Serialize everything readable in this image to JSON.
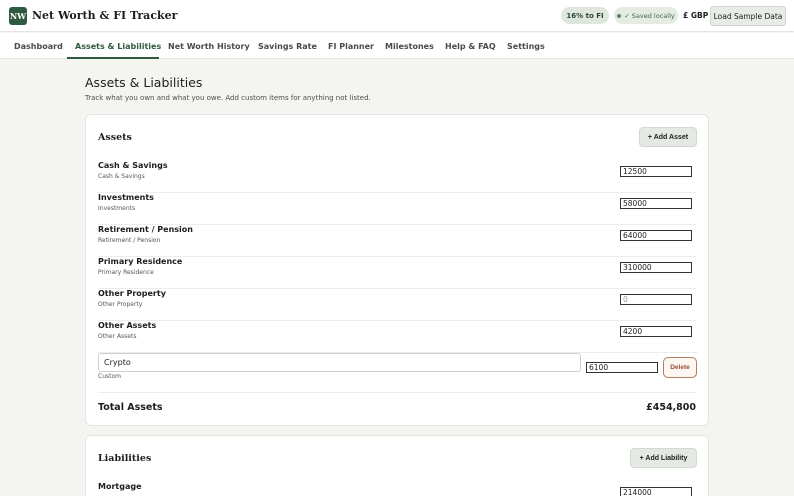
{
  "header": {
    "logo_text": "NW",
    "app_title": "Net Worth & FI Tracker",
    "fi_progress": "16% to FI",
    "saved_status": "✓ Saved locally",
    "currency": "£ GBP",
    "load_sample_label": "Load Sample Data"
  },
  "nav": {
    "tabs": [
      {
        "label": "Dashboard"
      },
      {
        "label": "Assets & Liabilities"
      },
      {
        "label": "Net Worth History"
      },
      {
        "label": "Savings Rate"
      },
      {
        "label": "FI Planner"
      },
      {
        "label": "Milestones"
      },
      {
        "label": "Help & FAQ"
      },
      {
        "label": "Settings"
      }
    ],
    "active_tab": "Assets & Liabilities"
  },
  "page": {
    "title": "Assets & Liabilities",
    "subtitle": "Track what you own and what you owe. Add custom items for anything not listed."
  },
  "assets": {
    "title": "Assets",
    "add_label": "+ Add Asset",
    "items": [
      {
        "name": "Cash & Savings",
        "sub": "Cash & Savings",
        "value": "12500",
        "placeholder": "0"
      },
      {
        "name": "Investments",
        "sub": "Investments",
        "value": "58000",
        "placeholder": "0"
      },
      {
        "name": "Retirement / Pension",
        "sub": "Retirement / Pension",
        "value": "64000",
        "placeholder": "0"
      },
      {
        "name": "Primary Residence",
        "sub": "Primary Residence",
        "value": "310000",
        "placeholder": "0"
      },
      {
        "name": "Other Property",
        "sub": "Other Property",
        "value": "",
        "placeholder": "0"
      },
      {
        "name": "Other Assets",
        "sub": "Other Assets",
        "value": "4200",
        "placeholder": "0"
      }
    ],
    "custom": {
      "name": "Crypto",
      "sub": "Custom",
      "value": "6100",
      "delete_label": "Delete"
    },
    "total_label": "Total Assets",
    "total_value": "£454,800"
  },
  "liabilities": {
    "title": "Liabilities",
    "add_label": "+ Add Liability",
    "items": [
      {
        "name": "Mortgage",
        "value": "214000"
      }
    ]
  },
  "colors": {
    "brand": "#2f5a3d",
    "background": "#f4f4f1",
    "delete": "#9a4a34"
  }
}
